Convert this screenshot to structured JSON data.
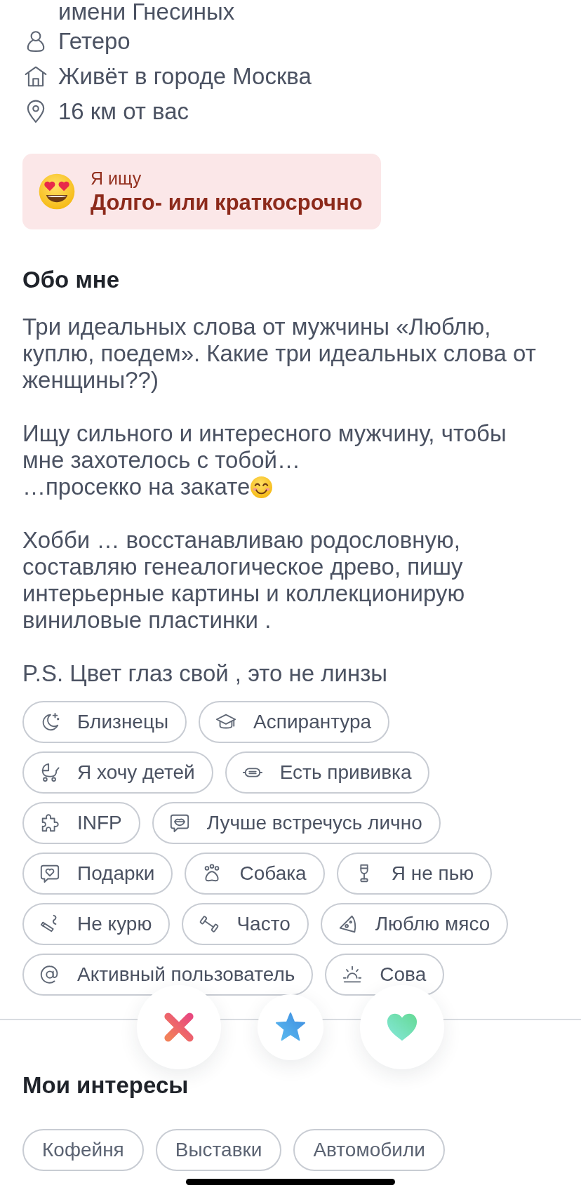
{
  "info_rows": [
    {
      "kind": "continued",
      "text": "имени Гнесиных"
    },
    {
      "kind": "orientation",
      "text": "Гетеро"
    },
    {
      "kind": "home_city",
      "text": "Живёт в городе Москва"
    },
    {
      "kind": "distance",
      "text": "16 км от вас"
    }
  ],
  "looking_for": {
    "label": "Я ищу",
    "value": "Долго- или краткосрочно"
  },
  "about": {
    "title": "Обо мне",
    "paragraphs": [
      {
        "text": "Три идеальных слова от мужчины «Люблю, куплю, поедем». Какие три идеальных слова от женщины??)"
      },
      {
        "text": "Ищу сильного и интересного мужчину, чтобы мне захотелось с тобой…\n…просекко на закате",
        "trailing_emoji": true
      },
      {
        "text": "Хобби … восстанавливаю родословную, составляю генеалогическое древо, пишу интерьерные картины и коллекционирую виниловые пластинки ."
      },
      {
        "text": "P.S. Цвет глаз свой , это не линзы"
      }
    ]
  },
  "badges": [
    {
      "kind": "zodiac",
      "label": "Близнецы"
    },
    {
      "kind": "education",
      "label": "Аспирантура"
    },
    {
      "kind": "family_plans",
      "label": "Я хочу детей"
    },
    {
      "kind": "covid_vaccine",
      "label": "Есть прививка"
    },
    {
      "kind": "personality",
      "label": "INFP"
    },
    {
      "kind": "communication",
      "label": "Лучше встречусь лично"
    },
    {
      "kind": "love_language",
      "label": "Подарки"
    },
    {
      "kind": "pets",
      "label": "Собака"
    },
    {
      "kind": "drinking",
      "label": "Я не пью"
    },
    {
      "kind": "smoking",
      "label": "Не курю"
    },
    {
      "kind": "exercise",
      "label": "Часто"
    },
    {
      "kind": "diet",
      "label": "Люблю мясо"
    },
    {
      "kind": "social_media",
      "label": "Активный пользователь"
    },
    {
      "kind": "sleep",
      "label": "Сова"
    }
  ],
  "actions": [
    {
      "kind": "pass"
    },
    {
      "kind": "superswipe"
    },
    {
      "kind": "like"
    }
  ],
  "interests": {
    "title": "Мои интересы",
    "items": [
      "Кофейня",
      "Выставки",
      "Автомобили"
    ]
  }
}
